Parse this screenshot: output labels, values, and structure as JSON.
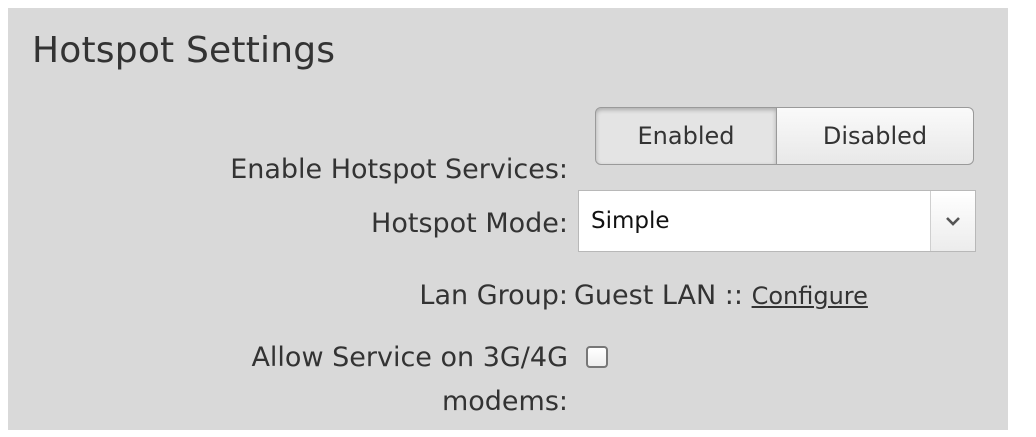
{
  "title": "Hotspot Settings",
  "enable_hotspot": {
    "label": "Enable Hotspot Services:",
    "options": [
      "Enabled",
      "Disabled"
    ],
    "selected": "Enabled"
  },
  "hotspot_mode": {
    "label": "Hotspot Mode:",
    "value": "Simple",
    "icon": "chevron-down-icon"
  },
  "lan_group": {
    "label": "Lan Group:",
    "value": "Guest LAN ::",
    "link": "Configure"
  },
  "allow_service": {
    "label_line1": "Allow Service on 3G/4G",
    "label_line2": "modems:",
    "checked": false
  },
  "colors": {
    "panel_bg": "#d9d9d9",
    "text": "#333333"
  }
}
